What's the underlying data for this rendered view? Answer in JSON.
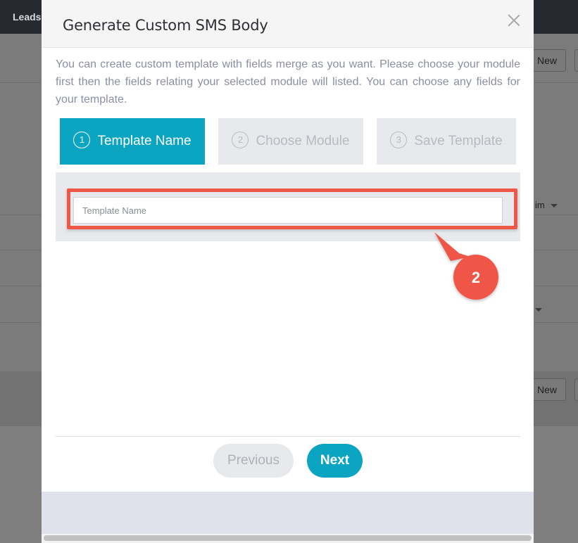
{
  "background": {
    "nav_tab": "Leads",
    "new_button_top": "New",
    "select_partial": "im",
    "new_button_bottom": "New"
  },
  "modal": {
    "title": "Generate Custom SMS Body",
    "close_icon": "close-icon",
    "intro_text": "You can create custom template with fields merge as you want. Please choose your module first then the fields relating your selected module will listed. You can choose any fields for your template.",
    "steps": [
      {
        "number": "1",
        "label": "Template Name",
        "active": true
      },
      {
        "number": "2",
        "label": "Choose Module",
        "active": false
      },
      {
        "number": "3",
        "label": "Save Template",
        "active": false
      }
    ],
    "template_name_input": {
      "placeholder": "Template Name",
      "value": ""
    },
    "annotation_badge": "2",
    "buttons": {
      "previous": "Previous",
      "next": "Next"
    }
  },
  "colors": {
    "accent": "#0ba5c2",
    "highlight": "#ef5747",
    "step_inactive": "#e8e9ec"
  }
}
